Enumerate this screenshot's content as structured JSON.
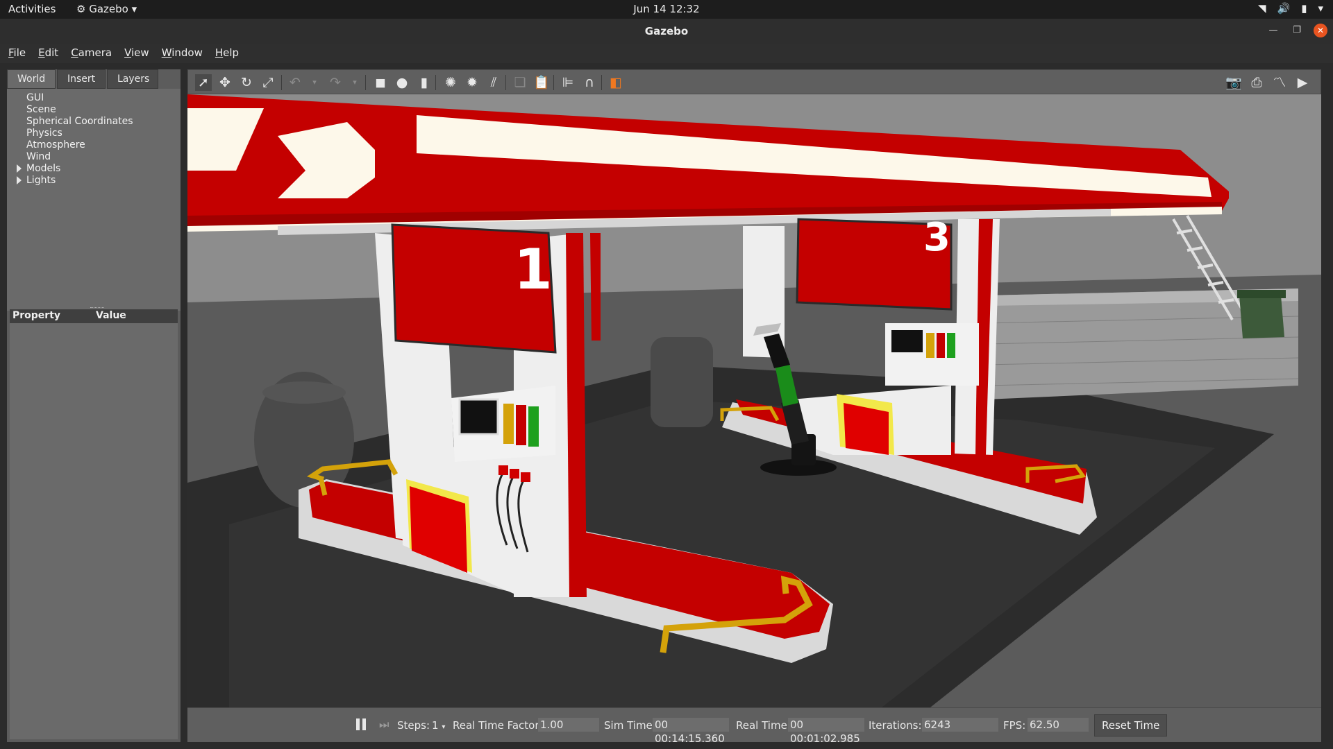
{
  "system_bar": {
    "activities": "Activities",
    "app_menu": "Gazebo",
    "clock": "Jun 14  12:32"
  },
  "window": {
    "title": "Gazebo"
  },
  "menubar": [
    "File",
    "Edit",
    "Camera",
    "View",
    "Window",
    "Help"
  ],
  "left_panel": {
    "tabs": [
      "World",
      "Insert",
      "Layers"
    ],
    "active_tab": "World",
    "tree": [
      {
        "label": "GUI",
        "expandable": false
      },
      {
        "label": "Scene",
        "expandable": false
      },
      {
        "label": "Spherical Coordinates",
        "expandable": false
      },
      {
        "label": "Physics",
        "expandable": false
      },
      {
        "label": "Atmosphere",
        "expandable": false
      },
      {
        "label": "Wind",
        "expandable": false
      },
      {
        "label": "Models",
        "expandable": true
      },
      {
        "label": "Lights",
        "expandable": true
      }
    ],
    "property_header": {
      "property": "Property",
      "value": "Value"
    }
  },
  "toolbar": {
    "icons": [
      "select-arrow-icon",
      "translate-icon",
      "rotate-icon",
      "scale-icon",
      "undo-icon",
      "redo-icon",
      "box-icon",
      "sphere-icon",
      "cylinder-icon",
      "point-light-icon",
      "spot-light-icon",
      "directional-light-icon",
      "copy-icon",
      "paste-icon",
      "align-icon",
      "snap-icon",
      "view-angle-icon",
      "screenshot-icon",
      "log-icon",
      "plot-icon",
      "record-video-icon"
    ]
  },
  "scene": {
    "pump_numbers": [
      "1",
      "3"
    ],
    "colors": {
      "canopy_red": "#c40000",
      "canopy_white": "#fdf8ea",
      "ground": "#5a5a5a",
      "asphalt": "#2a2a2a",
      "sky": "#8b8b8b",
      "accent_yellow": "#f2e84a",
      "trim_gold": "#d4a20a"
    }
  },
  "bottom_bar": {
    "steps_label": "Steps:",
    "steps_value": "1",
    "rtf_label": "Real Time Factor:",
    "rtf_value": "1.00",
    "sim_time_label": "Sim Time:",
    "sim_time_value": "00 00:14:15.360",
    "real_time_label": "Real Time:",
    "real_time_value": "00 00:01:02.985",
    "iterations_label": "Iterations:",
    "iterations_value": "6243",
    "fps_label": "FPS:",
    "fps_value": "62.50",
    "reset_label": "Reset Time"
  }
}
